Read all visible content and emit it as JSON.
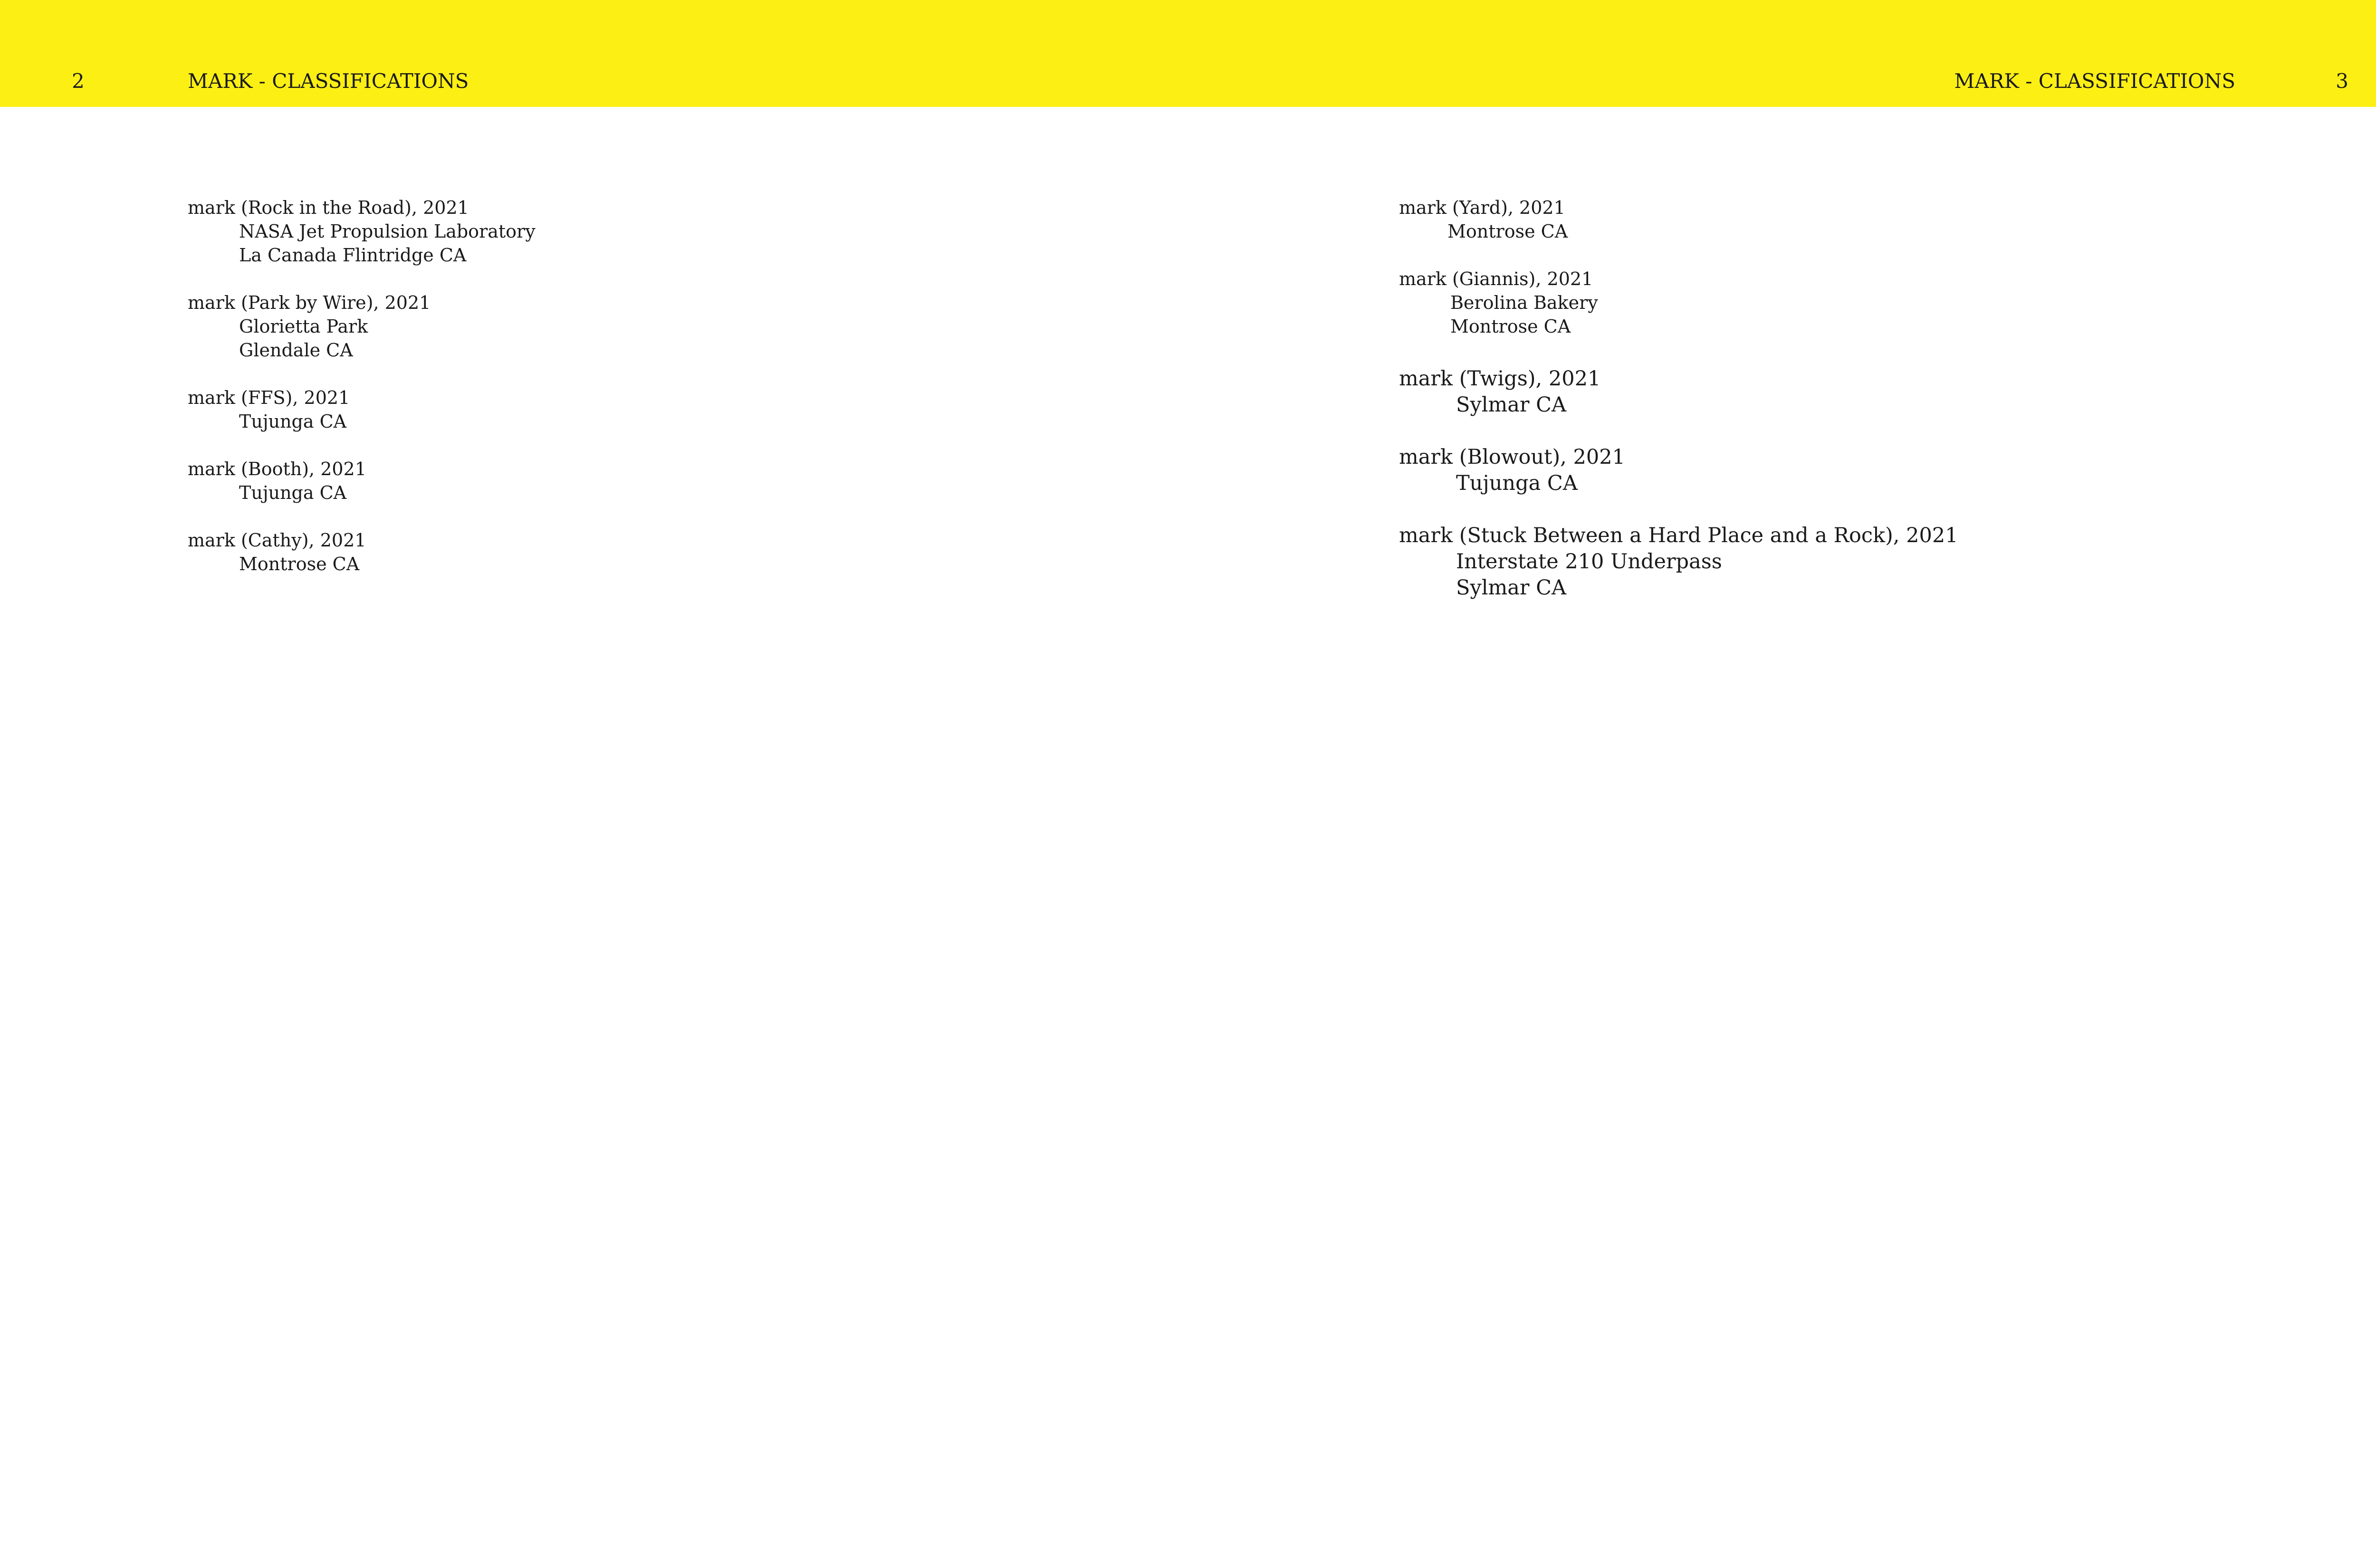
{
  "header": {
    "color": "#fcef14",
    "left_page_number": "2",
    "left_running_head": "MARK - CLASSIFICATIONS",
    "right_running_head": "MARK - CLASSIFICATIONS",
    "right_page_number": "3"
  },
  "left_page": {
    "entries": [
      {
        "title": "mark (Rock in the Road), 2021",
        "lines": [
          "NASA Jet Propulsion Laboratory",
          "La Canada Flintridge CA"
        ]
      },
      {
        "title": "mark (Park by Wire), 2021",
        "lines": [
          "Glorietta Park",
          "Glendale CA"
        ]
      },
      {
        "title": "mark (FFS), 2021",
        "lines": [
          "Tujunga CA"
        ]
      },
      {
        "title": "mark (Booth), 2021",
        "lines": [
          "Tujunga CA"
        ]
      },
      {
        "title": "mark (Cathy), 2021",
        "lines": [
          "Montrose CA"
        ]
      }
    ]
  },
  "right_page": {
    "entries": [
      {
        "title": "mark (Yard), 2021",
        "lines": [
          "Montrose CA"
        ]
      },
      {
        "title": "mark (Giannis), 2021",
        "lines": [
          "Berolina Bakery",
          "Montrose CA"
        ]
      },
      {
        "title": "mark (Twigs), 2021",
        "lines": [
          "Sylmar CA"
        ]
      },
      {
        "title": "mark (Blowout), 2021",
        "lines": [
          "Tujunga CA"
        ]
      },
      {
        "title": "mark (Stuck Between a Hard Place and a Rock), 2021",
        "lines": [
          "Interstate 210 Underpass",
          "Sylmar CA"
        ]
      }
    ]
  }
}
